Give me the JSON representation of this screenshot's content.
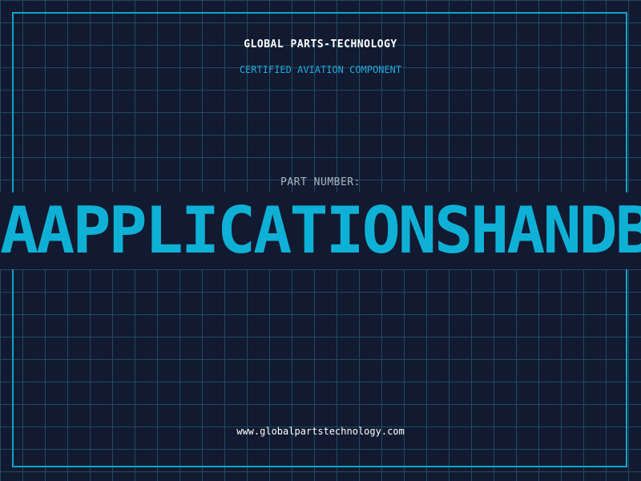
{
  "header": {
    "company_name": "GLOBAL PARTS-TECHNOLOGY",
    "tagline": "CERTIFIED AVIATION COMPONENT"
  },
  "part": {
    "label": "PART NUMBER:",
    "number": "AAPPLICATIONSHANDB"
  },
  "footer": {
    "website": "www.globalpartstechnology.com"
  },
  "colors": {
    "background": "#111a30",
    "grid": "#1f4a63",
    "accent": "#0fb0d6",
    "frame": "#0ea5c6"
  }
}
